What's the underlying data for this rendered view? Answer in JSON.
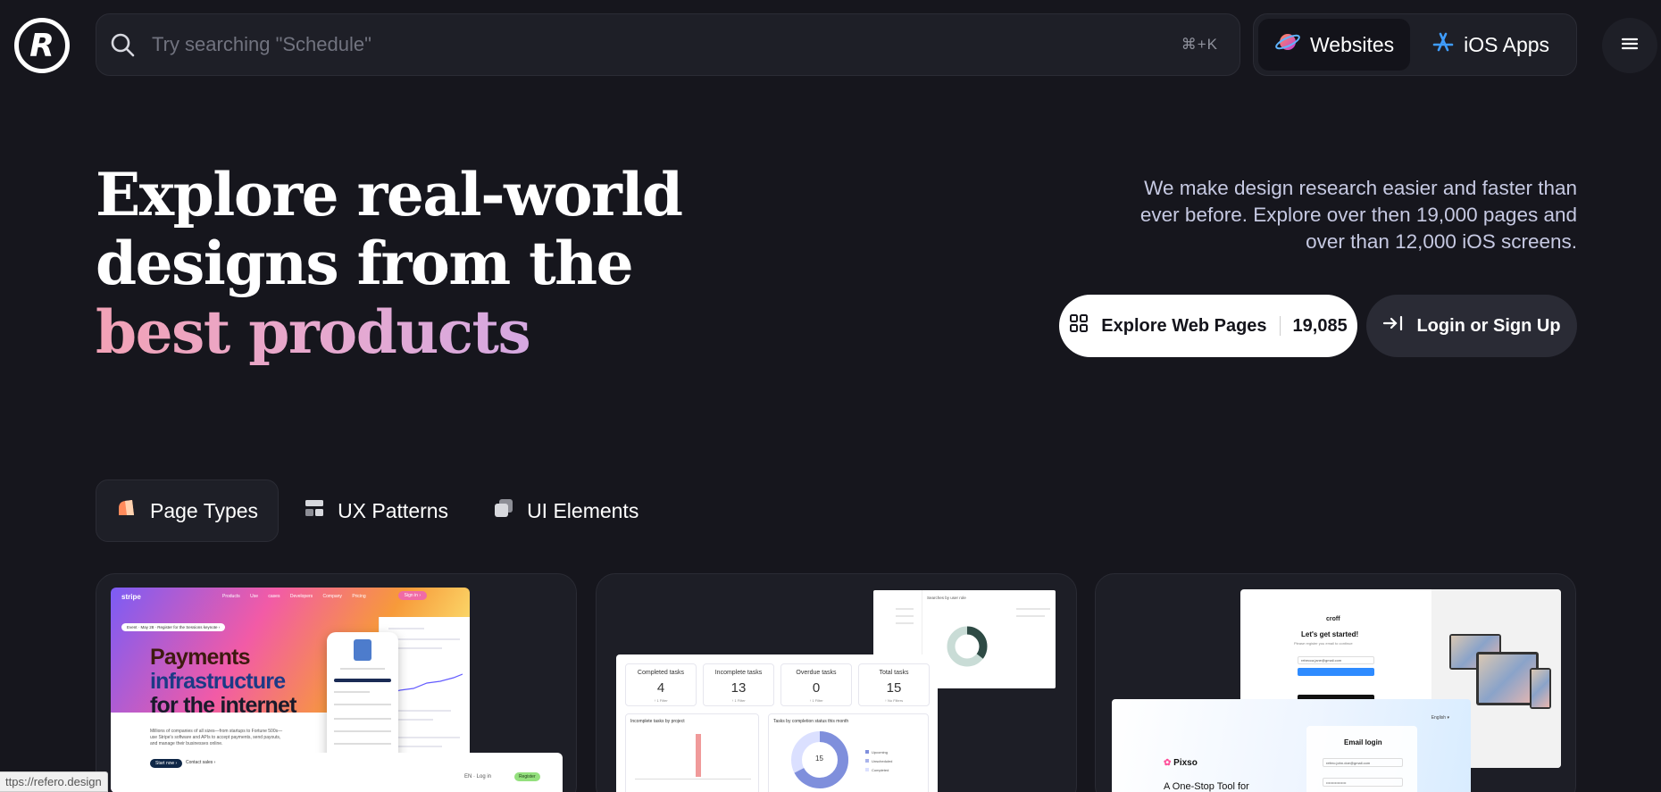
{
  "search": {
    "placeholder": "Try searching \"Schedule\"",
    "shortcut": "⌘+K"
  },
  "modes": [
    {
      "label": "Websites",
      "icon": "planet-icon",
      "active": true
    },
    {
      "label": "iOS Apps",
      "icon": "app-store-icon",
      "active": false
    }
  ],
  "hero": {
    "line1": "Explore real-world",
    "line2": "designs from the",
    "line3": "best products",
    "description": "We make design research easier and faster than ever before. Explore over then 19,000 pages and over than 12,000 iOS screens.",
    "explore_label": "Explore Web Pages",
    "explore_count": "19,085",
    "login_label": "Login or Sign Up"
  },
  "tabs": [
    {
      "label": "Page Types",
      "icon": "page-types-icon",
      "active": true
    },
    {
      "label": "UX Patterns",
      "icon": "ux-patterns-icon",
      "active": false
    },
    {
      "label": "UI Elements",
      "icon": "ui-elements-icon",
      "active": false
    }
  ],
  "card1": {
    "brand": "stripe",
    "nav_links": "Products Use cases Developers Company Pricing",
    "signin": "Sign in ›",
    "event_pill": "Event · May 28 · Register for the Sessions keynote ›",
    "headline_1": "Payments",
    "headline_2": "infrastructure",
    "headline_3": "for the internet",
    "subtext": "Millions of companies of all sizes—from startups to Fortune 500s—use Stripe's software and APIs to accept payments, send payouts, and manage their businesses online.",
    "start_btn": "Start now ›",
    "contact_btn": "Contact sales ›",
    "lang": "EN · Log in",
    "register": "Register"
  },
  "card2": {
    "stats": [
      {
        "label": "Completed tasks",
        "value": "4",
        "foot": "↑ 1 Filter"
      },
      {
        "label": "Incomplete tasks",
        "value": "13",
        "foot": "↑ 1 Filter"
      },
      {
        "label": "Overdue tasks",
        "value": "0",
        "foot": "↑ 1 Filter"
      },
      {
        "label": "Total tasks",
        "value": "15",
        "foot": "↑ No Filters"
      }
    ],
    "panel1_title": "Incomplete tasks by project",
    "panel2_title": "Tasks by completion status this month",
    "donut_value": "15",
    "legend": [
      "Upcoming",
      "Unscheduled",
      "Completed"
    ],
    "top_title": "Searches by user role"
  },
  "card3": {
    "brand": "croff",
    "heading": "Let's get started!",
    "sub": "Please register you email to continue",
    "email": "rebecca.jane@gmail.com",
    "pixso_brand": "Pixso",
    "pixso_tagline": "A One-Stop Tool for",
    "lang": "English ▾",
    "login_heading": "Email login",
    "login_email": "refero.john.doe@gmail.com"
  },
  "status_url": "ttps://refero.design"
}
